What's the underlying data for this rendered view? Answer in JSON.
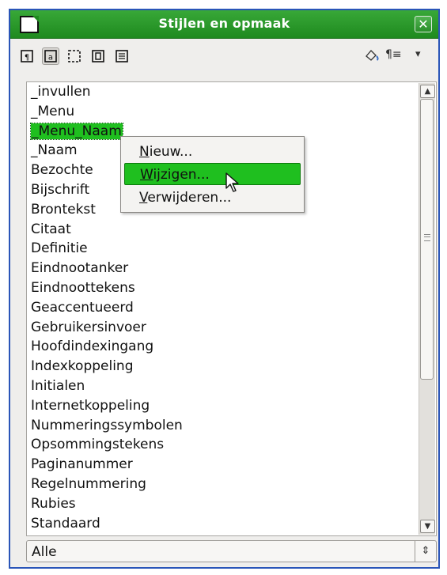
{
  "window": {
    "title": "Stijlen en opmaak",
    "close_symbol": "✕"
  },
  "toolbar": {
    "buttons": [
      {
        "name": "paragraph-styles",
        "icon": "paragraph-styles-icon"
      },
      {
        "name": "character-styles",
        "icon": "character-styles-icon",
        "active": true
      },
      {
        "name": "frame-styles",
        "icon": "frame-styles-icon"
      },
      {
        "name": "page-styles",
        "icon": "page-styles-icon"
      },
      {
        "name": "list-styles",
        "icon": "list-styles-icon"
      }
    ],
    "fill_format": "fill-format-icon",
    "new_style": "¶≡",
    "menu_arrow": "▾"
  },
  "styles_list": {
    "items": [
      "_invullen",
      "_Menu",
      "_Menu_Naam",
      "_Naam",
      "Bezochte",
      "Bijschrift",
      "Brontekst",
      "Citaat",
      "Definitie",
      "Eindnootanker",
      "Eindnoottekens",
      "Geaccentueerd",
      "Gebruikersinvoer",
      "Hoofdindexingang",
      "Indexkoppeling",
      "Initialen",
      "Internetkoppeling",
      "Nummeringssymbolen",
      "Opsommingstekens",
      "Paginanummer",
      "Regelnummering",
      "Rubies",
      "Standaard"
    ],
    "selected_index": 2,
    "scroll_up": "▲",
    "scroll_down": "▼"
  },
  "context_menu": {
    "items": [
      {
        "mnemonic": "N",
        "rest": "ieuw..."
      },
      {
        "mnemonic": "W",
        "rest": "ijzigen..."
      },
      {
        "mnemonic": "V",
        "rest": "erwijderen..."
      }
    ],
    "highlighted_index": 1
  },
  "filter": {
    "value": "Alle",
    "arrow": "⇕"
  }
}
